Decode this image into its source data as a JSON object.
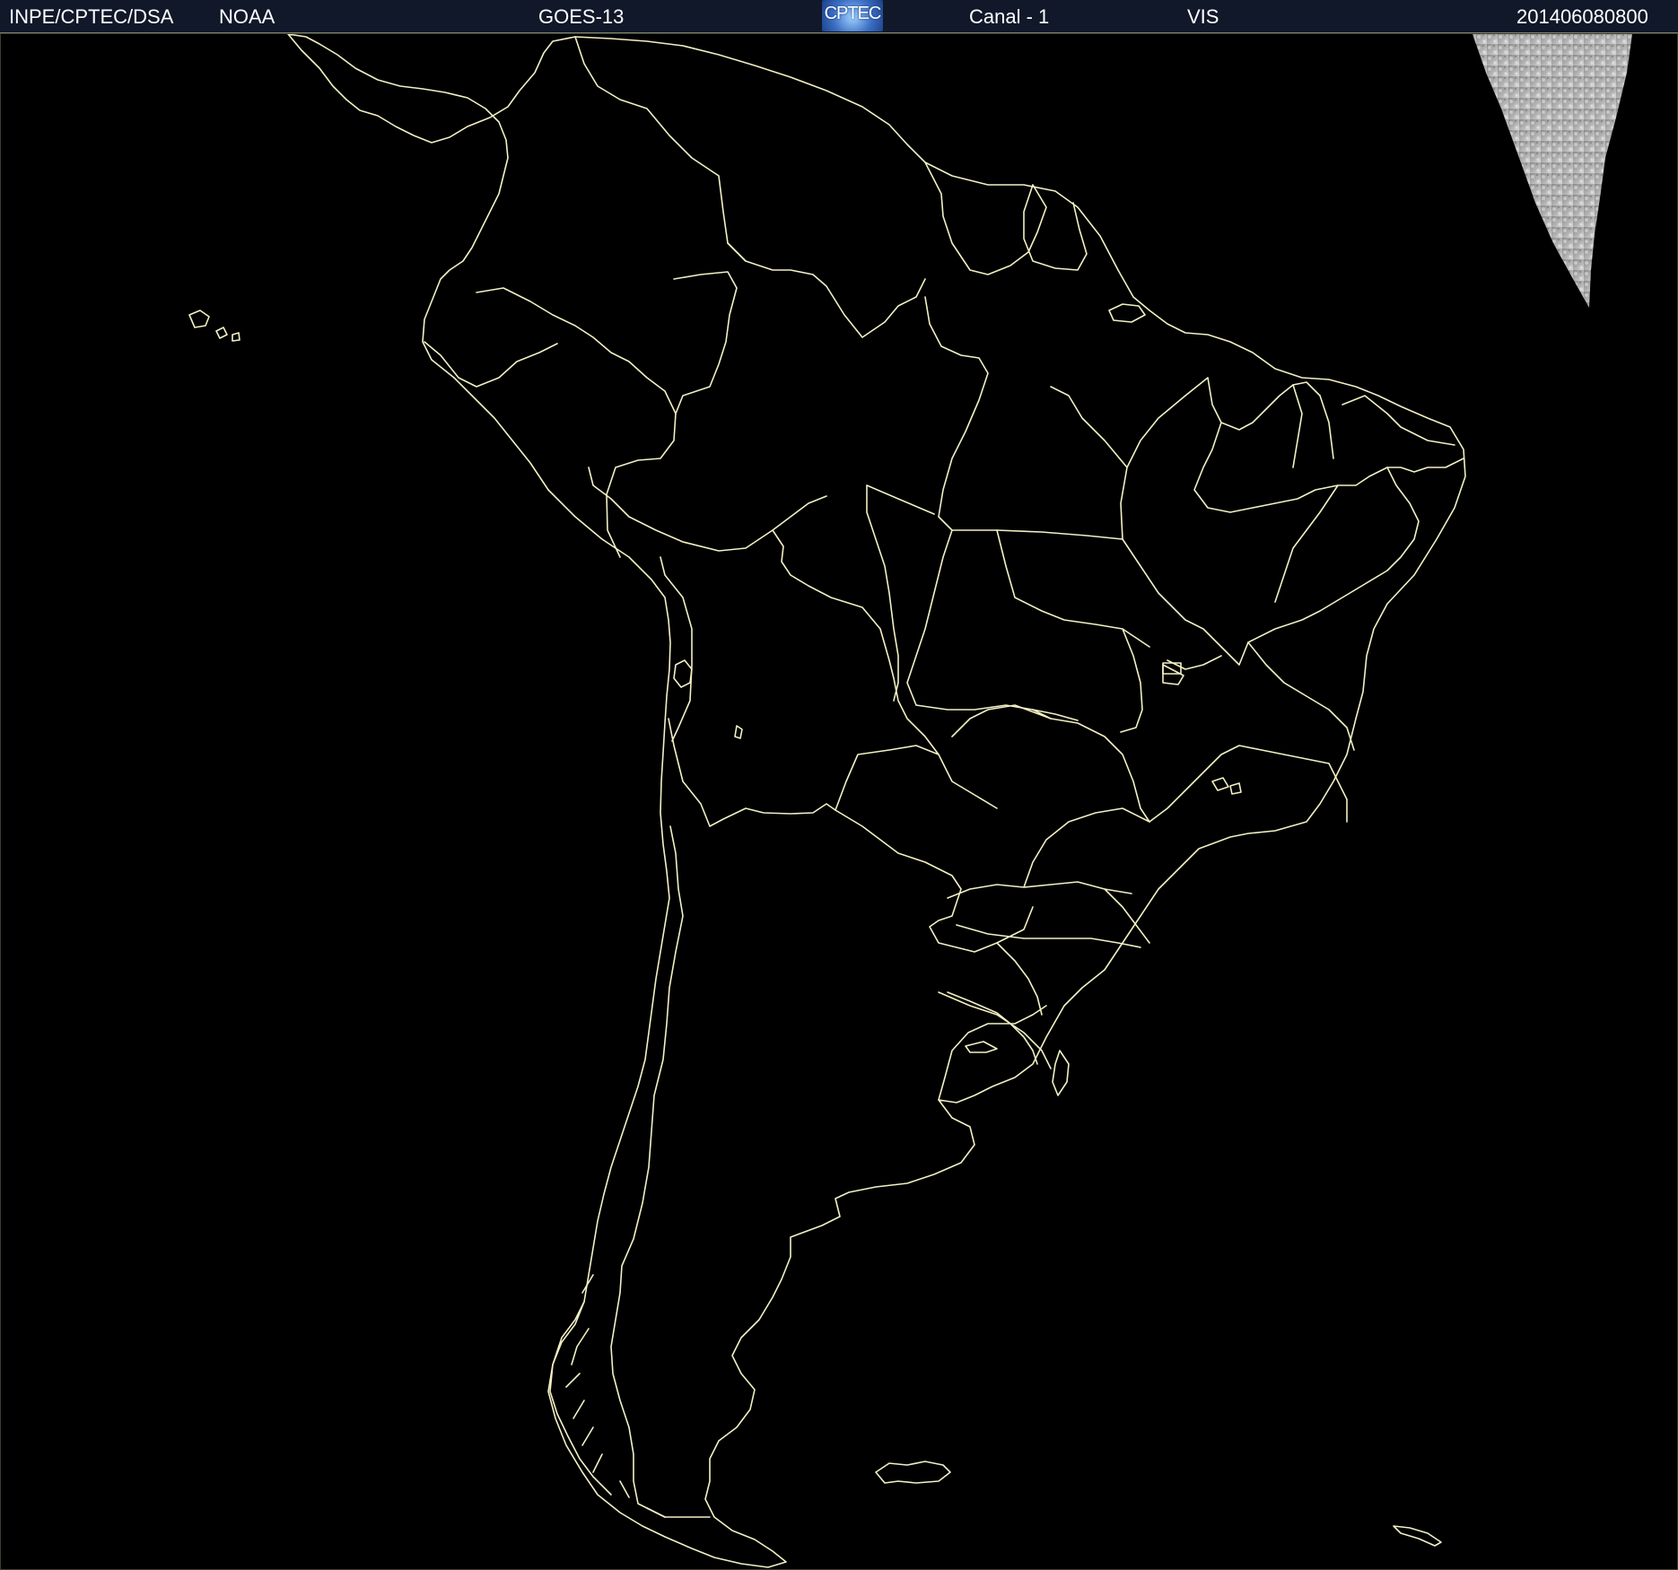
{
  "header": {
    "org": "INPE/CPTEC/DSA",
    "agency": "NOAA",
    "satellite": "GOES-13",
    "logo_text": "CPTEC",
    "channel": "Canal - 1",
    "band": "VIS",
    "timestamp": "201406080800"
  },
  "map": {
    "region": "South America",
    "boundary_color": "#f2f0c4",
    "background_color": "#000000",
    "imagery_brightness": "sunlit area visible only in the north-east corner"
  }
}
